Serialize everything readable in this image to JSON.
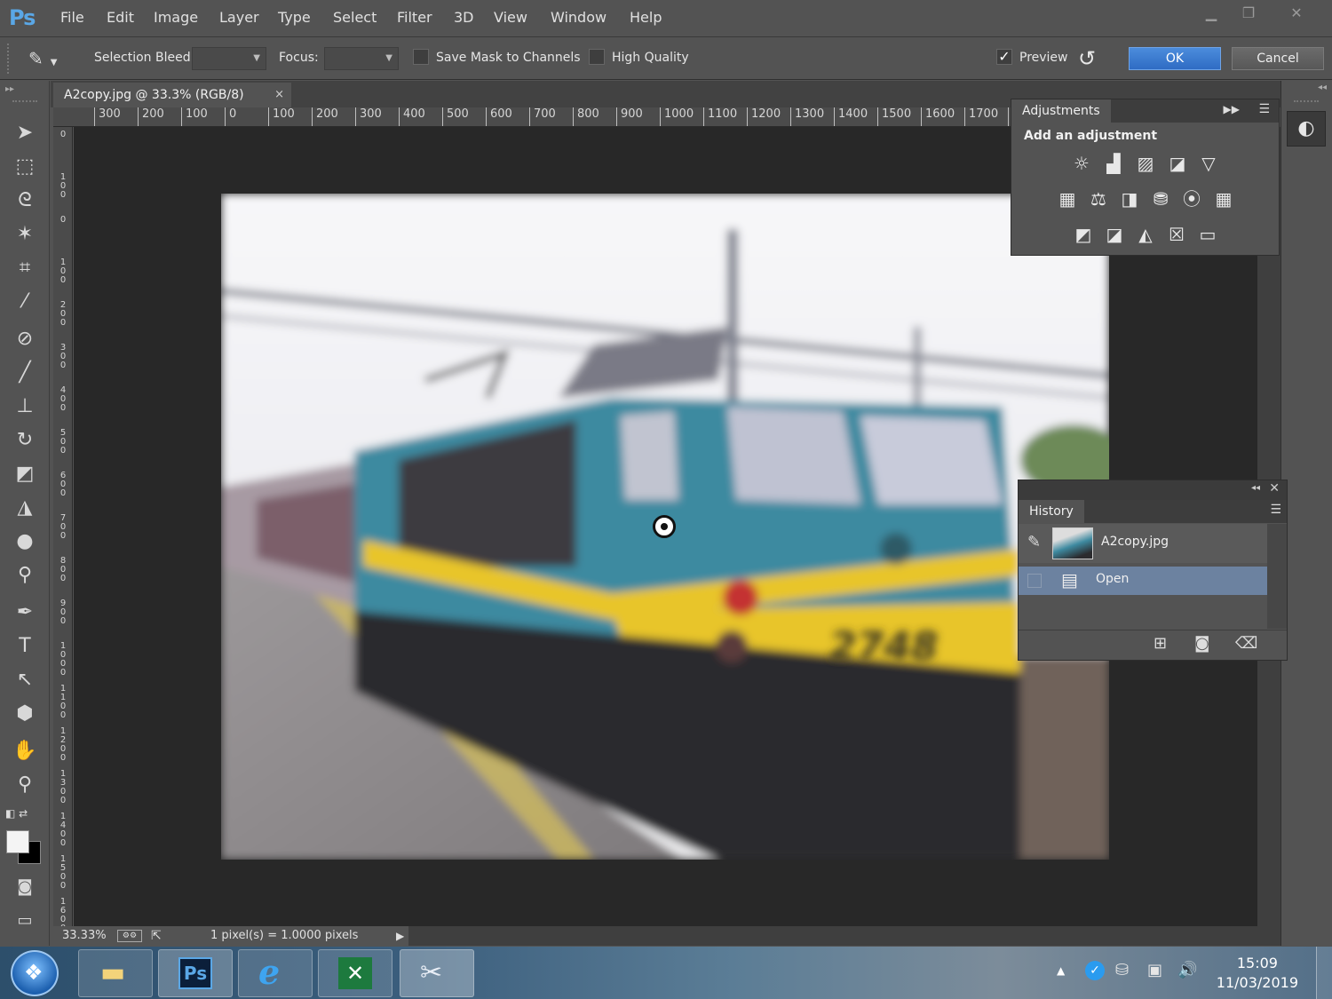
{
  "app": {
    "logo": "Ps"
  },
  "menu": [
    "File",
    "Edit",
    "Image",
    "Layer",
    "Type",
    "Select",
    "Filter",
    "3D",
    "View",
    "Window",
    "Help"
  ],
  "window_controls": {
    "minimize": "▁",
    "restore": "❐",
    "close": "✕"
  },
  "options_bar": {
    "selection_bleed_label": "Selection Bleed:",
    "selection_bleed_value": "",
    "focus_label": "Focus:",
    "focus_value": "",
    "save_mask_label": "Save Mask to Channels",
    "save_mask_checked": false,
    "high_quality_label": "High Quality",
    "high_quality_checked": false,
    "preview_label": "Preview",
    "preview_checked": true,
    "ok_label": "OK",
    "cancel_label": "Cancel"
  },
  "document": {
    "tab_title": "A2copy.jpg @ 33.3% (RGB/8)",
    "tab_close": "×",
    "ruler_top": [
      "300",
      "200",
      "100",
      "0",
      "100",
      "200",
      "300",
      "400",
      "500",
      "600",
      "700",
      "800",
      "900",
      "1000",
      "1100",
      "1200",
      "1300",
      "1400",
      "1500",
      "1600",
      "1700",
      "1"
    ],
    "ruler_left": [
      "0",
      "100",
      "0",
      "100",
      "200",
      "300",
      "400",
      "500",
      "600",
      "700",
      "800",
      "900",
      "1000",
      "1100",
      "1200",
      "1300",
      "1400",
      "1500",
      "1600"
    ],
    "loco_number": "2748"
  },
  "status": {
    "zoom": "33.33%",
    "info": "1 pixel(s) = 1.0000 pixels"
  },
  "adjustments": {
    "tab": "Adjustments",
    "subtitle": "Add an adjustment",
    "icons": [
      "brightness-contrast",
      "levels",
      "curves",
      "exposure",
      "vibrance",
      "hue-saturation",
      "color-balance",
      "black-white",
      "photo-filter",
      "channel-mixer",
      "color-lookup",
      "invert",
      "posterize",
      "threshold",
      "selective-color",
      "gradient-map"
    ]
  },
  "history": {
    "tab": "History",
    "snapshot_name": "A2copy.jpg",
    "steps": [
      "Open"
    ]
  },
  "taskbar": {
    "time": "15:09",
    "date": "11/03/2019",
    "apps": [
      "file-explorer",
      "photoshop",
      "internet-explorer",
      "excel",
      "snipping-tool"
    ]
  }
}
